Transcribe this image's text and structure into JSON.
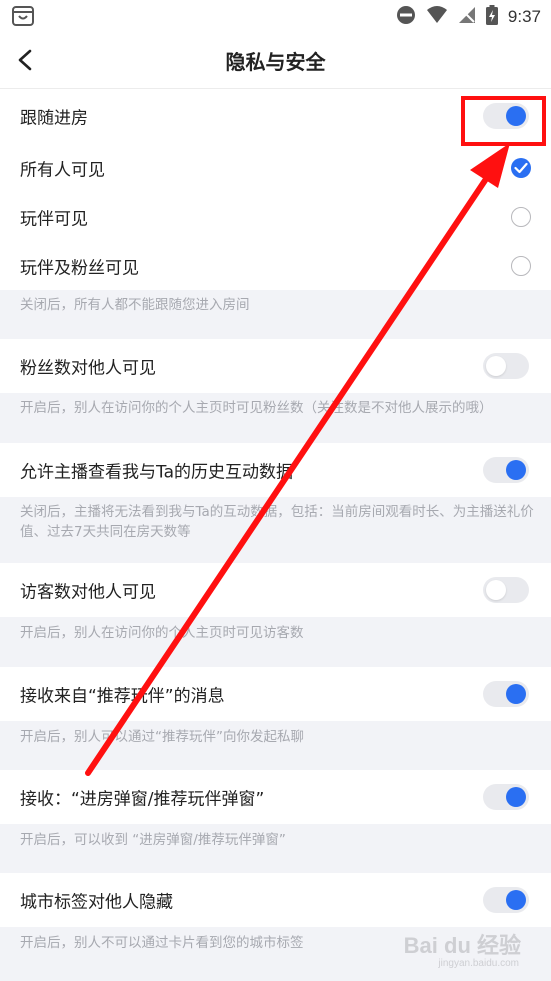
{
  "status_bar": {
    "time": "9:37"
  },
  "header": {
    "title": "隐私与安全"
  },
  "sections": {
    "follow": {
      "label": "跟随进房",
      "toggle": "on",
      "options": [
        {
          "label": "所有人可见",
          "selected": true
        },
        {
          "label": "玩伴可见",
          "selected": false
        },
        {
          "label": "玩伴及粉丝可见",
          "selected": false
        }
      ],
      "desc": "关闭后，所有人都不能跟随您进入房间"
    },
    "fans": {
      "label": "粉丝数对他人可见",
      "toggle": "off",
      "desc": "开启后，别人在访问你的个人主页时可见粉丝数（关注数是不对他人展示的哦）"
    },
    "history": {
      "label": "允许主播查看我与Ta的历史互动数据",
      "toggle": "on",
      "desc": "关闭后，主播将无法看到我与Ta的互动数据，包括：当前房间观看时长、为主播送礼价值、过去7天共同在房天数等"
    },
    "visitors": {
      "label": "访客数对他人可见",
      "toggle": "off",
      "desc": "开启后，别人在访问你的个人主页时可见访客数"
    },
    "recommend_msg": {
      "label": "接收来自“推荐玩伴”的消息",
      "toggle": "on",
      "desc": "开启后，别人可以通过“推荐玩伴”向你发起私聊"
    },
    "popup": {
      "label": "接收：“进房弹窗/推荐玩伴弹窗”",
      "toggle": "on",
      "desc": "开启后，可以收到 “进房弹窗/推荐玩伴弹窗”"
    },
    "city": {
      "label": "城市标签对他人隐藏",
      "toggle": "on",
      "desc": "开启后，别人不可以通过卡片看到您的城市标签"
    }
  },
  "watermark": {
    "brand": "Bai du 经验",
    "sub": "jingyan.baidu.com"
  },
  "colors": {
    "accent": "#2a6ff2",
    "annotation": "#ff1010",
    "background": "#f2f3f7"
  }
}
